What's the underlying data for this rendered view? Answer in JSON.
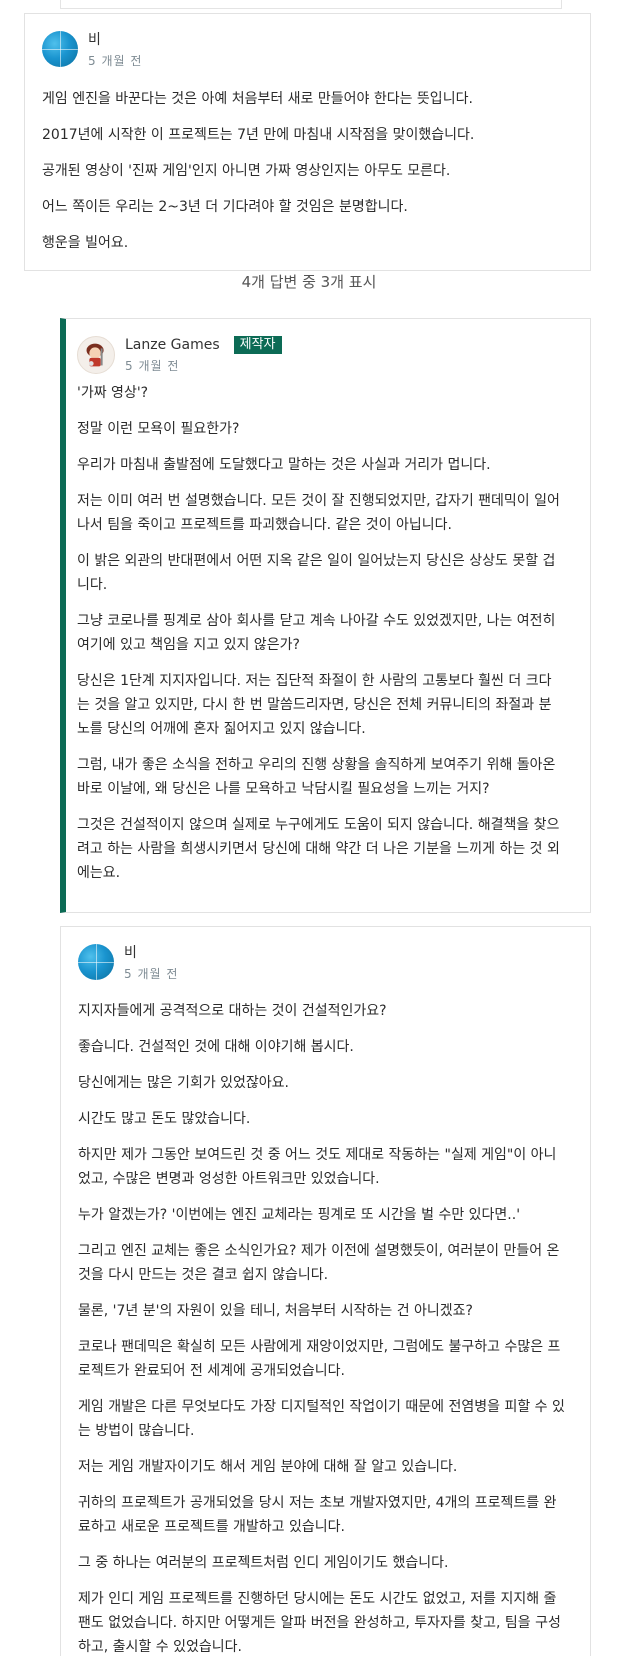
{
  "comments": [
    {
      "author": "비",
      "time": "5 개월 전",
      "paragraphs": [
        "게임 엔진을 바꾼다는 것은 아예 처음부터 새로 만들어야 한다는 뜻입니다.",
        "2017년에 시작한 이 프로젝트는 7년 만에 마침내 시작점을 맞이했습니다.",
        "공개된 영상이 '진짜 게임'인지 아니면 가짜 영상인지는 아무도 모른다.",
        "어느 쪽이든 우리는 2~3년 더 기다려야 할 것임은 분명합니다.",
        "행운을 빌어요."
      ]
    },
    {
      "author": "Lanze Games",
      "badge": "제작자",
      "time": "5 개월 전",
      "paragraphs": [
        "'가짜 영상'?",
        "정말 이런 모욕이 필요한가?",
        "우리가 마침내 출발점에 도달했다고 말하는 것은 사실과 거리가 멉니다.",
        "저는 이미 여러 번 설명했습니다. 모든 것이 잘 진행되었지만, 갑자기 팬데믹이 일어나서 팀을 죽이고 프로젝트를 파괴했습니다. 같은 것이 아닙니다.",
        "이 밝은 외관의 반대편에서 어떤 지옥 같은 일이 일어났는지 당신은 상상도 못할 겁니다.",
        "그냥 코로나를 핑계로 삼아 회사를 닫고 계속 나아갈 수도 있었겠지만, 나는 여전히 여기에 있고 책임을 지고 있지 않은가?",
        "당신은 1단계 지지자입니다. 저는 집단적 좌절이 한 사람의 고통보다 훨씬 더 크다는 것을 알고 있지만, 다시 한 번 말씀드리자면, 당신은 전체 커뮤니티의 좌절과 분노를 당신의 어깨에 혼자 짊어지고 있지 않습니다.",
        "그럼, 내가 좋은 소식을 전하고 우리의 진행 상황을 솔직하게 보여주기 위해 돌아온 바로 이날에, 왜 당신은 나를 모욕하고 낙담시킬 필요성을 느끼는 거지?",
        "그것은 건설적이지 않으며 실제로 누구에게도 도움이 되지 않습니다. 해결책을 찾으려고 하는 사람을 희생시키면서 당신에 대해 약간 더 나은 기분을 느끼게 하는 것 외에는요."
      ]
    },
    {
      "author": "비",
      "time": "5 개월 전",
      "paragraphs": [
        "지지자들에게 공격적으로 대하는 것이 건설적인가요?",
        "좋습니다. 건설적인 것에 대해 이야기해 봅시다.",
        "당신에게는 많은 기회가 있었잖아요.",
        "시간도 많고 돈도 많았습니다.",
        "하지만 제가 그동안 보여드린 것 중 어느 것도 제대로 작동하는 \"실제 게임\"이 아니었고, 수많은 변명과 엉성한 아트워크만 있었습니다.",
        "누가 알겠는가? '이번에는 엔진 교체라는 핑계로 또 시간을 벌 수만 있다면..'",
        "그리고 엔진 교체는 좋은 소식인가요? 제가 이전에 설명했듯이, 여러분이 만들어 온 것을 다시 만드는 것은 결코 쉽지 않습니다.",
        "물론, '7년 분'의 자원이 있을 테니, 처음부터 시작하는 건 아니겠죠?",
        "코로나 팬데믹은 확실히 모든 사람에게 재앙이었지만, 그럼에도 불구하고 수많은 프로젝트가 완료되어 전 세계에 공개되었습니다.",
        "게임 개발은 다른 무엇보다도 가장 디지털적인 작업이기 때문에 전염병을 피할 수 있는 방법이 많습니다.",
        "저는 게임 개발자이기도 해서 게임 분야에 대해 잘 알고 있습니다.",
        "귀하의 프로젝트가 공개되었을 당시 저는 초보 개발자였지만, 4개의 프로젝트를 완료하고 새로운 프로젝트를 개발하고 있습니다.",
        "그 중 하나는 여러분의 프로젝트처럼 인디 게임이기도 했습니다.",
        "제가 인디 게임 프로젝트를 진행하던 당시에는 돈도 시간도 없었고, 저를 지지해 줄 팬도 없었습니다. 하지만 어떻게든 알파 버전을 완성하고, 투자자를 찾고, 팀을 구성하고, 출시할 수 있었습니다."
      ]
    }
  ],
  "replies_shown": "4개 답변 중 3개 표시"
}
